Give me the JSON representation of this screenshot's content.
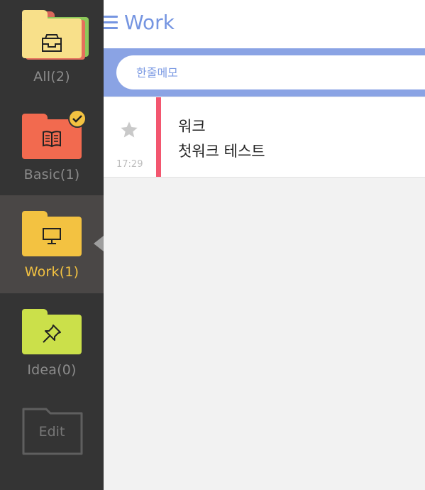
{
  "sidebar": {
    "folders": [
      {
        "label": "All(2)",
        "icon": "inbox-icon",
        "color": "#f8e08a"
      },
      {
        "label": "Basic(1)",
        "icon": "book-icon",
        "color": "#f26a4f",
        "selected_check": true
      },
      {
        "label": "Work(1)",
        "icon": "monitor-icon",
        "color": "#f3c241",
        "active": true
      },
      {
        "label": "Idea(0)",
        "icon": "pin-icon",
        "color": "#cbe04a"
      }
    ],
    "edit_label": "Edit"
  },
  "header": {
    "title": "Work",
    "menu_icon": "hamburger-icon"
  },
  "search": {
    "placeholder": "한줄메모"
  },
  "memos": [
    {
      "title": "워크",
      "body": "첫워크 테스트",
      "time": "17:29",
      "starred": false,
      "accent_color": "#f3566f"
    }
  ],
  "colors": {
    "accent": "#7595e1",
    "sidebar_bg": "#343434",
    "active_label": "#f3c241"
  }
}
